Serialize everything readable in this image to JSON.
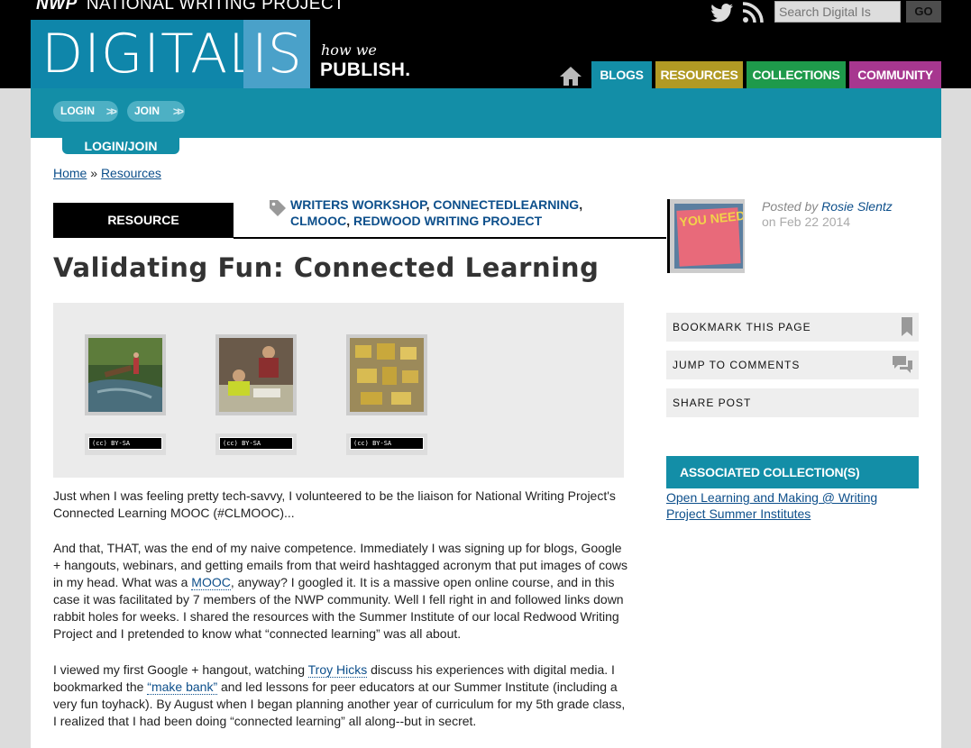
{
  "header": {
    "org_mark": "NWP",
    "org_name": "NATIONAL WRITING PROJECT",
    "logo_part1": "DIGITAL",
    "logo_part2": "IS",
    "tagline_small": "how we",
    "tagline_big": "PUBLISH.",
    "social_icons": [
      "twitter-icon",
      "rss-icon"
    ],
    "search": {
      "placeholder": "Search Digital Is",
      "button": "GO"
    },
    "nav": {
      "home_icon": "home-icon",
      "tabs": [
        {
          "label": "BLOGS",
          "color": "#138ea7"
        },
        {
          "label": "RESOURCES",
          "color": "#b19a24"
        },
        {
          "label": "COLLECTIONS",
          "color": "#1e9a4b"
        },
        {
          "label": "COMMUNITY",
          "color": "#a7378f"
        }
      ]
    }
  },
  "account_bar": {
    "login": "LOGIN",
    "join": "JOIN",
    "tab": "LOGIN/JOIN"
  },
  "breadcrumb": {
    "items": [
      "Home",
      "Resources"
    ],
    "separator": "»"
  },
  "article": {
    "type_label": "RESOURCE",
    "tags": [
      "WRITERS WORKSHOP",
      "CONNECTEDLEARNING",
      "CLMOOC",
      "REDWOOD WRITING PROJECT"
    ],
    "title": "Validating Fun: Connected Learning",
    "gallery": {
      "license_label": "(cc) BY-SA",
      "images": [
        "creek-photo",
        "classroom-photo",
        "gold-objects-photo"
      ]
    },
    "paragraphs": {
      "p1": "Just when I was feeling pretty tech-savvy, I volunteered to be the liaison for National Writing Project's Connected Learning MOOC (#CLMOOC)...",
      "p2_a": "And that, THAT, was the end of my naive competence. Immediately I was signing up for blogs, Google + hangouts, webinars, and getting emails from that weird hashtagged acronym that put images of cows in my head. What was a ",
      "p2_link": "MOOC",
      "p2_b": ", anyway? I googled it. It is a massive open online course, and in this case it was facilitated by 7 members of the NWP community. Well I fell right in and followed links down rabbit holes for weeks. I shared the resources with the Summer Institute of our local Redwood Writing Project and I pretended to know what “connected learning” was all about.",
      "p3_a": "I viewed my first Google + hangout, watching ",
      "p3_link1": "Troy Hicks",
      "p3_b": " discuss his experiences with digital media. I bookmarked the ",
      "p3_link2": "“make bank”",
      "p3_c": " and led lessons for peer educators at our Summer Institute (including a very fun toyhack). By August when I began planning another year of curriculum for my 5th grade class, I realized that I had been doing “connected learning” all along--but in secret."
    }
  },
  "sidebar": {
    "posted_by_label": "Posted by",
    "author": "Rosie Slentz",
    "posted_on": "on Feb 22 2014",
    "author_image_text": "YOU NEED TO BE AWESOME",
    "actions": [
      {
        "label": "BOOKMARK THIS PAGE",
        "icon": "bookmark-icon"
      },
      {
        "label": "JUMP TO COMMENTS",
        "icon": "comments-icon"
      },
      {
        "label": "SHARE POST",
        "icon": ""
      }
    ],
    "associated_title": "ASSOCIATED COLLECTION(S)",
    "associated_link": "Open Learning and Making @ Writing Project Summer Institutes"
  },
  "colors": {
    "teal": "#138ea7",
    "link": "#0d4f8b",
    "logo_dark": "#0f86aa",
    "logo_light": "#4aa1c9"
  }
}
